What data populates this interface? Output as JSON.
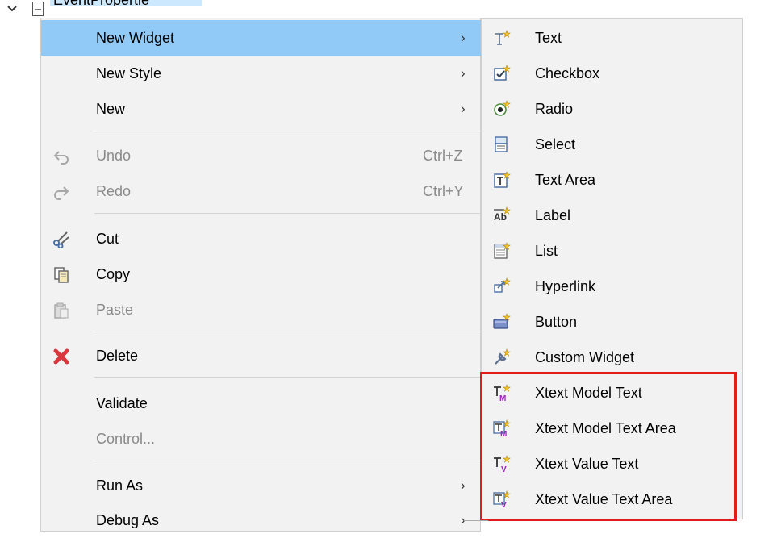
{
  "tree": {
    "item_label": "EventPropertie"
  },
  "context_menu": {
    "items": [
      {
        "label": "New Widget",
        "submenu": true,
        "highlighted": true
      },
      {
        "label": "New Style",
        "submenu": true
      },
      {
        "label": "New",
        "submenu": true
      },
      {
        "label": "Undo",
        "shortcut": "Ctrl+Z",
        "disabled": true,
        "icon": "undo-icon"
      },
      {
        "label": "Redo",
        "shortcut": "Ctrl+Y",
        "disabled": true,
        "icon": "redo-icon"
      },
      {
        "label": "Cut",
        "icon": "scissors-icon"
      },
      {
        "label": "Copy",
        "icon": "copy-icon"
      },
      {
        "label": "Paste",
        "disabled": true,
        "icon": "paste-icon"
      },
      {
        "label": "Delete",
        "icon": "delete-icon"
      },
      {
        "label": "Validate"
      },
      {
        "label": "Control...",
        "disabled": true
      },
      {
        "label": "Run As",
        "submenu": true
      },
      {
        "label": "Debug As",
        "submenu": true
      }
    ],
    "submenu_arrow": "›"
  },
  "widget_submenu": {
    "items": [
      {
        "label": "Text",
        "icon": "text-widget-icon"
      },
      {
        "label": "Checkbox",
        "icon": "checkbox-widget-icon"
      },
      {
        "label": "Radio",
        "icon": "radio-widget-icon"
      },
      {
        "label": "Select",
        "icon": "select-widget-icon"
      },
      {
        "label": "Text Area",
        "icon": "text-area-widget-icon"
      },
      {
        "label": "Label",
        "icon": "label-widget-icon"
      },
      {
        "label": "List",
        "icon": "list-widget-icon"
      },
      {
        "label": "Hyperlink",
        "icon": "hyperlink-widget-icon"
      },
      {
        "label": "Button",
        "icon": "button-widget-icon"
      },
      {
        "label": "Custom Widget",
        "icon": "custom-widget-icon"
      },
      {
        "label": "Xtext Model Text",
        "icon": "xtext-model-text-icon"
      },
      {
        "label": "Xtext Model Text Area",
        "icon": "xtext-model-text-area-icon"
      },
      {
        "label": "Xtext Value Text",
        "icon": "xtext-value-text-icon"
      },
      {
        "label": "Xtext Value Text Area",
        "icon": "xtext-value-text-area-icon"
      }
    ]
  },
  "colors": {
    "highlight": "#91c9f7",
    "menu_bg": "#f2f2f2",
    "annotation_box": "#e21b1b"
  }
}
